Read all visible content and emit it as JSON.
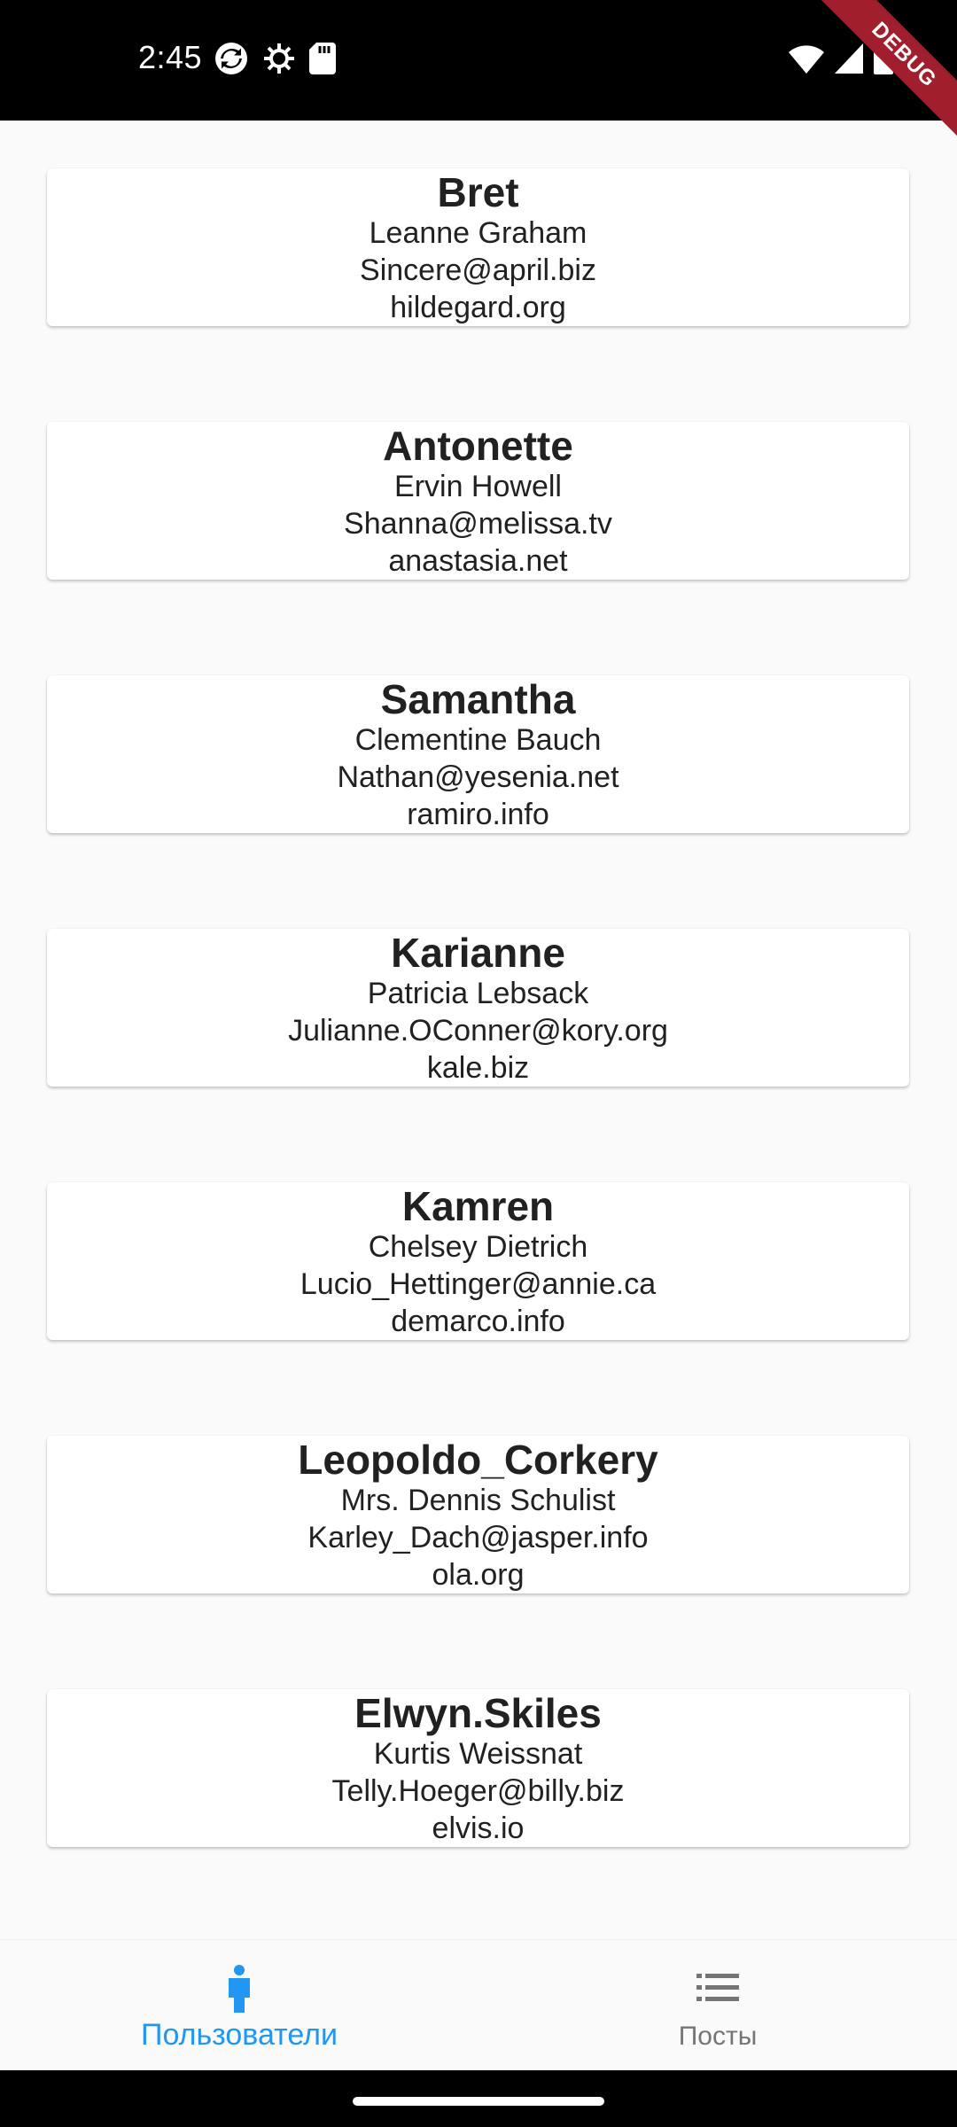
{
  "status_bar": {
    "time": "2:45",
    "left_icons": [
      "sync-icon",
      "settings-icon",
      "sd-card-icon"
    ],
    "right_icons": [
      "wifi-icon",
      "signal-icon",
      "battery-icon"
    ],
    "debug_label": "DEBUG"
  },
  "users": [
    {
      "username": "Bret",
      "name": "Leanne Graham",
      "email": "Sincere@april.biz",
      "website": "hildegard.org"
    },
    {
      "username": "Antonette",
      "name": "Ervin Howell",
      "email": "Shanna@melissa.tv",
      "website": "anastasia.net"
    },
    {
      "username": "Samantha",
      "name": "Clementine Bauch",
      "email": "Nathan@yesenia.net",
      "website": "ramiro.info"
    },
    {
      "username": "Karianne",
      "name": "Patricia Lebsack",
      "email": "Julianne.OConner@kory.org",
      "website": "kale.biz"
    },
    {
      "username": "Kamren",
      "name": "Chelsey Dietrich",
      "email": "Lucio_Hettinger@annie.ca",
      "website": "demarco.info"
    },
    {
      "username": "Leopoldo_Corkery",
      "name": "Mrs. Dennis Schulist",
      "email": "Karley_Dach@jasper.info",
      "website": "ola.org"
    },
    {
      "username": "Elwyn.Skiles",
      "name": "Kurtis Weissnat",
      "email": "Telly.Hoeger@billy.biz",
      "website": "elvis.io"
    }
  ],
  "bottom_nav": {
    "items": [
      {
        "label": "Пользователи",
        "icon": "person-icon",
        "selected": true
      },
      {
        "label": "Посты",
        "icon": "list-icon",
        "selected": false
      }
    ]
  },
  "colors": {
    "accent": "#2196f3",
    "inactive": "#757575",
    "card_text": "#212121",
    "background": "#fafafa"
  }
}
